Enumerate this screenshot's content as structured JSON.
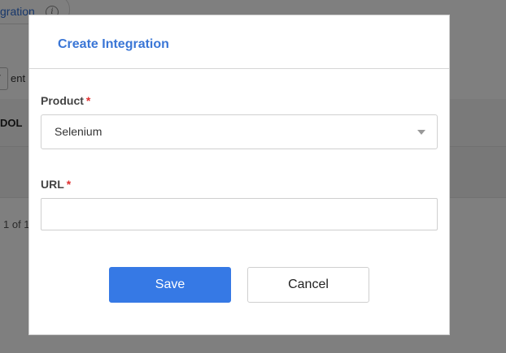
{
  "background": {
    "tab_label": "gration",
    "entries_label": "ent",
    "column_header": "DOL",
    "pagination_text": "1 of 1"
  },
  "modal": {
    "title": "Create Integration",
    "product": {
      "label": "Product",
      "required_mark": "*",
      "selected_value": "Selenium"
    },
    "url": {
      "label": "URL",
      "required_mark": "*",
      "value": "",
      "placeholder": ""
    },
    "save_label": "Save",
    "cancel_label": "Cancel"
  },
  "colors": {
    "accent": "#3679e5",
    "title": "#3a76d6",
    "required": "#e03030",
    "overlay": "rgba(0,0,0,0.5)"
  },
  "icons": {
    "info": "info-icon",
    "caret": "caret-down-icon"
  }
}
